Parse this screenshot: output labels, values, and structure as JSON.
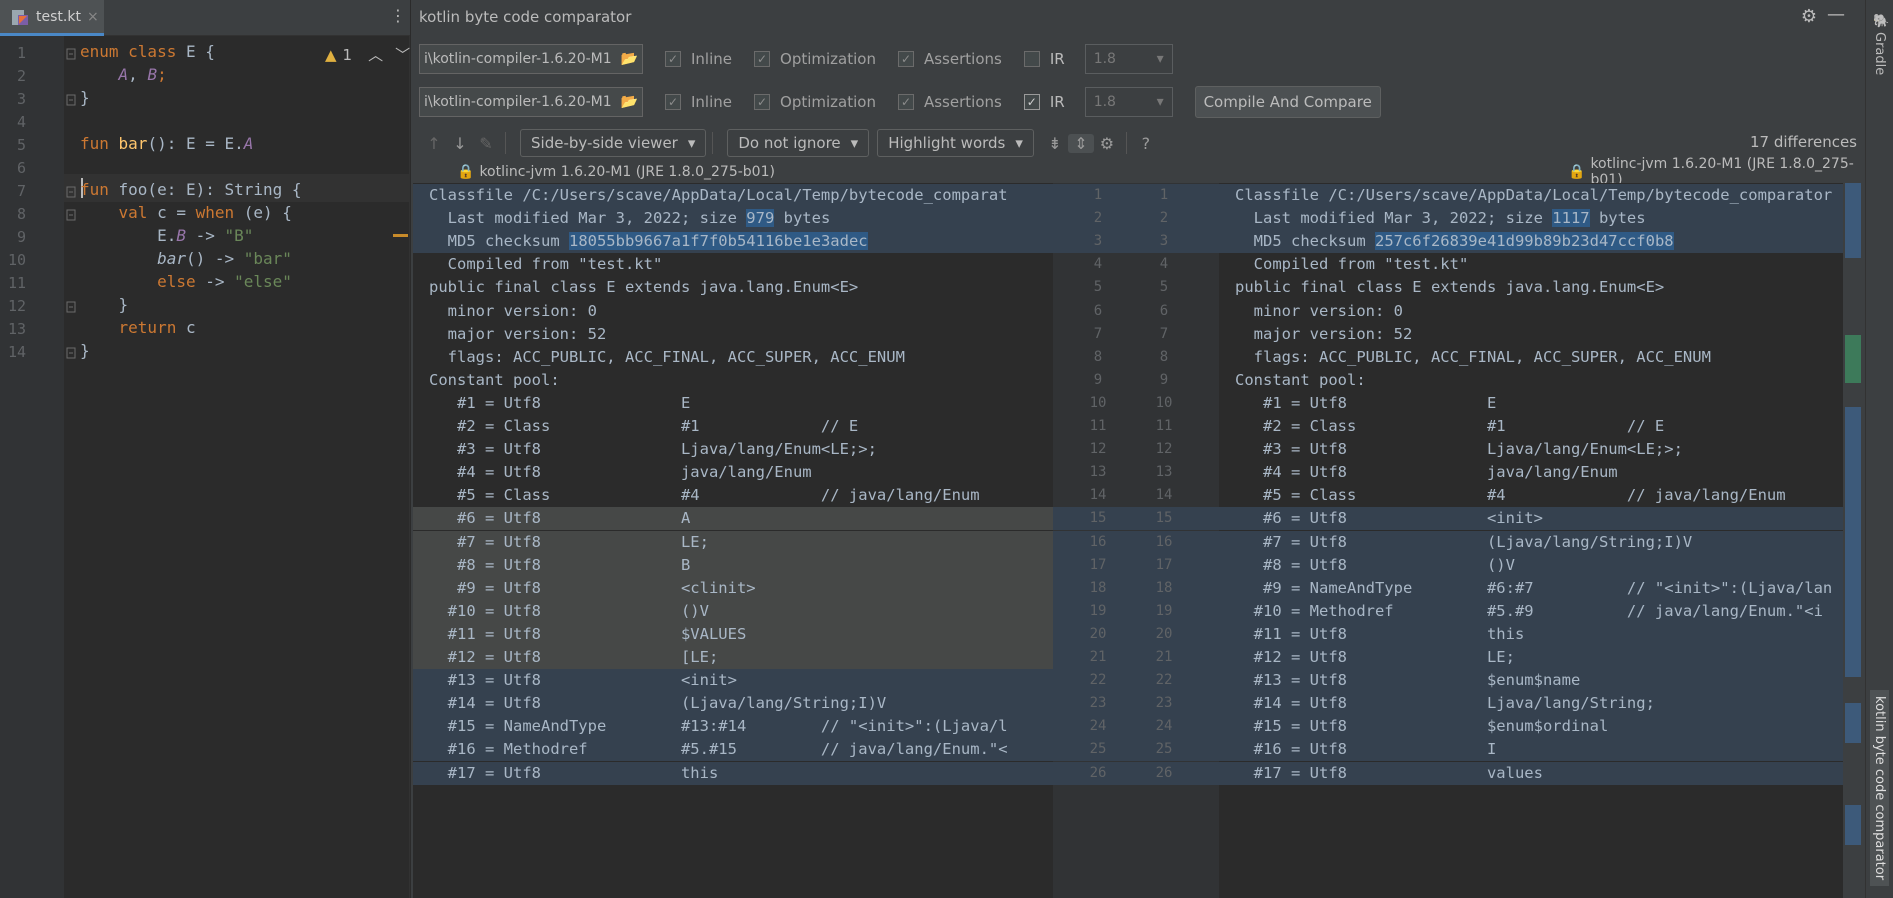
{
  "editor": {
    "tab_label": "test.kt",
    "tab_close": "×",
    "warnings_count": "1",
    "lines": [
      {
        "n": "1",
        "parts": [
          [
            "kw",
            "enum class "
          ],
          [
            "",
            "E {"
          ]
        ]
      },
      {
        "n": "2",
        "parts": [
          [
            "",
            "    "
          ],
          [
            "en",
            "A"
          ],
          [
            "",
            ", "
          ],
          [
            "en",
            "B"
          ],
          [
            "kw",
            ";"
          ]
        ]
      },
      {
        "n": "3",
        "parts": [
          [
            "",
            "}"
          ]
        ]
      },
      {
        "n": "4",
        "parts": []
      },
      {
        "n": "5",
        "parts": [
          [
            "kw",
            "fun "
          ],
          [
            "fn",
            "bar"
          ],
          [
            "",
            "(): E = E."
          ],
          [
            "en",
            "A"
          ]
        ]
      },
      {
        "n": "6",
        "parts": []
      },
      {
        "n": "7",
        "parts": [
          [
            "kw",
            "fun "
          ],
          [
            "",
            "foo(e: E): String {"
          ]
        ]
      },
      {
        "n": "8",
        "parts": [
          [
            "",
            "    "
          ],
          [
            "kw",
            "val "
          ],
          [
            "",
            "c = "
          ],
          [
            "kw",
            "when "
          ],
          [
            "",
            "(e) {"
          ]
        ]
      },
      {
        "n": "9",
        "parts": [
          [
            "",
            "        E."
          ],
          [
            "en",
            "B"
          ],
          [
            "",
            " -> "
          ],
          [
            "st",
            "\"B\""
          ]
        ]
      },
      {
        "n": "10",
        "parts": [
          [
            "",
            "        "
          ],
          [
            "it",
            "bar"
          ],
          [
            "",
            "() -> "
          ],
          [
            "st",
            "\"bar\""
          ]
        ]
      },
      {
        "n": "11",
        "parts": [
          [
            "",
            "        "
          ],
          [
            "kw",
            "else"
          ],
          [
            "",
            " -> "
          ],
          [
            "st",
            "\"else\""
          ]
        ]
      },
      {
        "n": "12",
        "parts": [
          [
            "",
            "    }"
          ]
        ]
      },
      {
        "n": "13",
        "parts": [
          [
            "",
            "    "
          ],
          [
            "kw",
            "return "
          ],
          [
            "",
            "c"
          ]
        ]
      },
      {
        "n": "14",
        "parts": [
          [
            "",
            "}"
          ]
        ]
      }
    ]
  },
  "comparator": {
    "title": "kotlin byte code comparator",
    "row1": {
      "path": "i\\kotlin-compiler-1.6.20-M1",
      "inline": "Inline",
      "optimization": "Optimization",
      "assertions": "Assertions",
      "ir": "IR",
      "ir_checked": false,
      "version": "1.8"
    },
    "row2": {
      "path": "i\\kotlin-compiler-1.6.20-M1",
      "inline": "Inline",
      "optimization": "Optimization",
      "assertions": "Assertions",
      "ir": "IR",
      "ir_checked": true,
      "version": "1.8"
    },
    "compile_button": "Compile And Compare",
    "viewer_mode": "Side-by-side viewer",
    "ignore_mode": "Do not ignore",
    "highlight_mode": "Highlight words",
    "help": "?",
    "diff_count": "17 differences",
    "left_header": "kotlinc-jvm 1.6.20-M1 (JRE 1.8.0_275-b01)",
    "right_header": "kotlinc-jvm 1.6.20-M1 (JRE 1.8.0_275-b01)"
  },
  "diff": {
    "left": [
      {
        "t": "Classfile /C:/Users/scave/AppData/Local/Temp/bytecode_comparat",
        "bg": "b"
      },
      {
        "t": "  Last modified Mar 3, 2022; size 979 bytes",
        "bg": "b",
        "w": "979"
      },
      {
        "t": "  MD5 checksum 18055bb9667a1f7f0b54116be1e3adec",
        "bg": "b",
        "w": "18055bb9667a1f7f0b54116be1e3adec"
      },
      {
        "t": "  Compiled from \"test.kt\"",
        "bg": ""
      },
      {
        "t": "public final class E extends java.lang.Enum<E>",
        "bg": ""
      },
      {
        "t": "  minor version: 0",
        "bg": ""
      },
      {
        "t": "  major version: 52",
        "bg": ""
      },
      {
        "t": "  flags: ACC_PUBLIC, ACC_FINAL, ACC_SUPER, ACC_ENUM",
        "bg": ""
      },
      {
        "t": "Constant pool:",
        "bg": ""
      },
      {
        "t": "   #1 = Utf8               E",
        "bg": ""
      },
      {
        "t": "   #2 = Class              #1             // E",
        "bg": ""
      },
      {
        "t": "   #3 = Utf8               Ljava/lang/Enum<LE;>;",
        "bg": ""
      },
      {
        "t": "   #4 = Utf8               java/lang/Enum",
        "bg": ""
      },
      {
        "t": "   #5 = Class              #4             // java/lang/Enum",
        "bg": ""
      },
      {
        "t": "   #6 = Utf8               A",
        "bg": "g"
      },
      {
        "t": "   #7 = Utf8               LE;",
        "bg": "g"
      },
      {
        "t": "   #8 = Utf8               B",
        "bg": "g"
      },
      {
        "t": "   #9 = Utf8               <clinit>",
        "bg": "g"
      },
      {
        "t": "  #10 = Utf8               ()V",
        "bg": "g"
      },
      {
        "t": "  #11 = Utf8               $VALUES",
        "bg": "g"
      },
      {
        "t": "  #12 = Utf8               [LE;",
        "bg": "g"
      },
      {
        "t": "  #13 = Utf8               <init>",
        "bg": "b"
      },
      {
        "t": "  #14 = Utf8               (Ljava/lang/String;I)V",
        "bg": "b"
      },
      {
        "t": "  #15 = NameAndType        #13:#14        // \"<init>\":(Ljava/l",
        "bg": "b"
      },
      {
        "t": "  #16 = Methodref          #5.#15         // java/lang/Enum.\"<",
        "bg": "b"
      },
      {
        "t": "  #17 = Utf8               this",
        "bg": "b"
      }
    ],
    "right": [
      {
        "t": "Classfile /C:/Users/scave/AppData/Local/Temp/bytecode_comparator",
        "bg": "b"
      },
      {
        "t": "  Last modified Mar 3, 2022; size 1117 bytes",
        "bg": "b",
        "w": "1117"
      },
      {
        "t": "  MD5 checksum 257c6f26839e41d99b89b23d47ccf0b8",
        "bg": "b",
        "w": "257c6f26839e41d99b89b23d47ccf0b8"
      },
      {
        "t": "  Compiled from \"test.kt\"",
        "bg": ""
      },
      {
        "t": "public final class E extends java.lang.Enum<E>",
        "bg": ""
      },
      {
        "t": "  minor version: 0",
        "bg": ""
      },
      {
        "t": "  major version: 52",
        "bg": ""
      },
      {
        "t": "  flags: ACC_PUBLIC, ACC_FINAL, ACC_SUPER, ACC_ENUM",
        "bg": ""
      },
      {
        "t": "Constant pool:",
        "bg": ""
      },
      {
        "t": "   #1 = Utf8               E",
        "bg": ""
      },
      {
        "t": "   #2 = Class              #1             // E",
        "bg": ""
      },
      {
        "t": "   #3 = Utf8               Ljava/lang/Enum<LE;>;",
        "bg": ""
      },
      {
        "t": "   #4 = Utf8               java/lang/Enum",
        "bg": ""
      },
      {
        "t": "   #5 = Class              #4             // java/lang/Enum",
        "bg": ""
      },
      {
        "t": "   #6 = Utf8               <init>",
        "bg": "b"
      },
      {
        "t": "   #7 = Utf8               (Ljava/lang/String;I)V",
        "bg": "b"
      },
      {
        "t": "   #8 = Utf8               ()V",
        "bg": "b"
      },
      {
        "t": "   #9 = NameAndType        #6:#7          // \"<init>\":(Ljava/lan",
        "bg": "b"
      },
      {
        "t": "  #10 = Methodref          #5.#9          // java/lang/Enum.\"<i",
        "bg": "b"
      },
      {
        "t": "  #11 = Utf8               this",
        "bg": "b"
      },
      {
        "t": "  #12 = Utf8               LE;",
        "bg": "b"
      },
      {
        "t": "  #13 = Utf8               $enum$name",
        "bg": "b"
      },
      {
        "t": "  #14 = Utf8               Ljava/lang/String;",
        "bg": "b"
      },
      {
        "t": "  #15 = Utf8               $enum$ordinal",
        "bg": "b"
      },
      {
        "t": "  #16 = Utf8               I",
        "bg": "b"
      },
      {
        "t": "  #17 = Utf8               values",
        "bg": "b"
      }
    ],
    "numbers": [
      "1",
      "2",
      "3",
      "4",
      "5",
      "6",
      "7",
      "8",
      "9",
      "10",
      "11",
      "12",
      "13",
      "14",
      "15",
      "16",
      "17",
      "18",
      "19",
      "20",
      "21",
      "22",
      "23",
      "24",
      "25",
      "26"
    ]
  },
  "sidebar": {
    "gradle": "Gradle",
    "comparator": "kotlin byte code comparator"
  },
  "colors": {
    "accent": "#4a88c7",
    "change": "#35414f",
    "gray_block": "#464847",
    "word_hl": "#2f5a85"
  }
}
